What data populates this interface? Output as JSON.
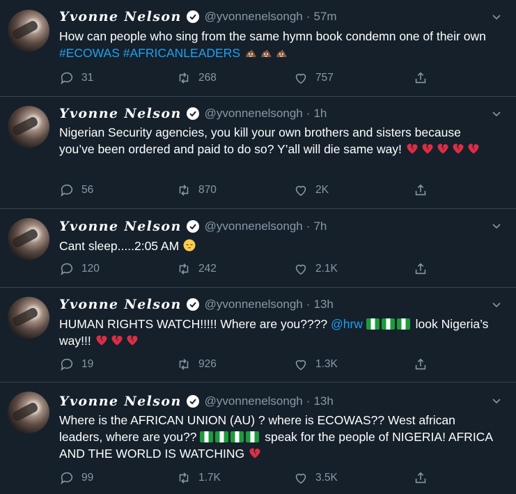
{
  "tweets": [
    {
      "name": "Yvonne Nelson",
      "handle": "@yvonnenelsongh",
      "time": "57m",
      "text": [
        {
          "t": "text",
          "v": "How can people who sing from the same hymn book condemn one of their own "
        },
        {
          "t": "hashtag",
          "v": "#ECOWAS"
        },
        {
          "t": "text",
          "v": " "
        },
        {
          "t": "hashtag",
          "v": "#AFRICANLEADERS"
        },
        {
          "t": "text",
          "v": " "
        },
        {
          "t": "emoji",
          "icon": "poop-emoji"
        },
        {
          "t": "emoji",
          "icon": "poop-emoji"
        },
        {
          "t": "emoji",
          "icon": "poop-emoji"
        }
      ],
      "replies": "31",
      "retweets": "268",
      "likes": "757"
    },
    {
      "name": "Yvonne Nelson",
      "handle": "@yvonnenelsongh",
      "time": "1h",
      "text": [
        {
          "t": "text",
          "v": "Nigerian Security agencies, you kill your own brothers and sisters because you’ve been ordered and paid to do so? Y’all will die same way! "
        },
        {
          "t": "emoji",
          "icon": "broken-heart-emoji"
        },
        {
          "t": "emoji",
          "icon": "broken-heart-emoji"
        },
        {
          "t": "emoji",
          "icon": "broken-heart-emoji"
        },
        {
          "t": "emoji",
          "icon": "broken-heart-emoji"
        },
        {
          "t": "emoji",
          "icon": "broken-heart-emoji"
        }
      ],
      "replies": "56",
      "retweets": "870",
      "likes": "2K"
    },
    {
      "name": "Yvonne Nelson",
      "handle": "@yvonnenelsongh",
      "time": "7h",
      "text": [
        {
          "t": "text",
          "v": "Cant sleep.....2:05 AM "
        },
        {
          "t": "emoji",
          "icon": "pensive-face-emoji"
        }
      ],
      "replies": "120",
      "retweets": "242",
      "likes": "2.1K"
    },
    {
      "name": "Yvonne Nelson",
      "handle": "@yvonnenelsongh",
      "time": "13h",
      "text": [
        {
          "t": "text",
          "v": "HUMAN RIGHTS WATCH!!!!! Where are you???? "
        },
        {
          "t": "mention",
          "v": "@hrw"
        },
        {
          "t": "text",
          "v": " "
        },
        {
          "t": "emoji",
          "icon": "nigeria-flag-emoji"
        },
        {
          "t": "emoji",
          "icon": "nigeria-flag-emoji"
        },
        {
          "t": "emoji",
          "icon": "nigeria-flag-emoji"
        },
        {
          "t": "text",
          "v": " look Nigeria’s way!!! "
        },
        {
          "t": "emoji",
          "icon": "broken-heart-emoji"
        },
        {
          "t": "emoji",
          "icon": "broken-heart-emoji"
        },
        {
          "t": "emoji",
          "icon": "broken-heart-emoji"
        }
      ],
      "replies": "19",
      "retweets": "926",
      "likes": "1.3K"
    },
    {
      "name": "Yvonne Nelson",
      "handle": "@yvonnenelsongh",
      "time": "13h",
      "text": [
        {
          "t": "text",
          "v": "Where is the AFRICAN UNION (AU) ? where is ECOWAS?? West african leaders, where are you?? "
        },
        {
          "t": "emoji",
          "icon": "nigeria-flag-emoji"
        },
        {
          "t": "emoji",
          "icon": "nigeria-flag-emoji"
        },
        {
          "t": "emoji",
          "icon": "nigeria-flag-emoji"
        },
        {
          "t": "emoji",
          "icon": "nigeria-flag-emoji"
        },
        {
          "t": "text",
          "v": " speak for the people of NIGERIA! AFRICA AND THE WORLD IS WATCHING "
        },
        {
          "t": "emoji",
          "icon": "broken-heart-emoji"
        }
      ],
      "replies": "99",
      "retweets": "1.7K",
      "likes": "3.5K"
    }
  ],
  "colors": {
    "background": "#15202b",
    "secondary_text": "#8899a6",
    "link": "#1da1f2",
    "divider": "#38444d"
  }
}
